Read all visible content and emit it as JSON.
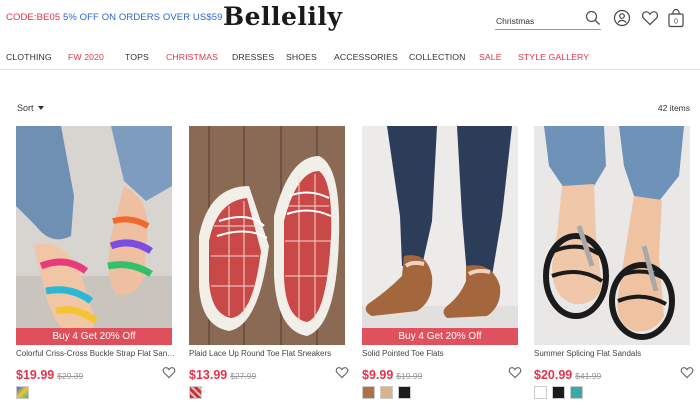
{
  "header": {
    "promo_code": "CODE:BE05",
    "promo_text": "5% OFF ON ORDERS OVER US$59",
    "logo": "Bellelily",
    "search_value": "Christmas",
    "cart_count": "0"
  },
  "nav": [
    {
      "label": "CLOTHING",
      "highlight": false
    },
    {
      "label": "FW 2020",
      "highlight": true
    },
    {
      "label": "TOPS",
      "highlight": false
    },
    {
      "label": "CHRISTMAS",
      "highlight": true
    },
    {
      "label": "DRESSES",
      "highlight": false
    },
    {
      "label": "SHOES",
      "highlight": false
    },
    {
      "label": "ACCESSORIES",
      "highlight": false
    },
    {
      "label": "COLLECTION",
      "highlight": false
    },
    {
      "label": "SALE",
      "highlight": true
    },
    {
      "label": "STYLE GALLERY",
      "highlight": true
    }
  ],
  "toolbar": {
    "sort_label": "Sort",
    "item_count": "42 items"
  },
  "colors": {
    "accent": "#e0344a",
    "promo_blue": "#2a66c7",
    "promo_strip": "#e04452"
  },
  "products": [
    {
      "name": "Colorful Criss-Cross Buckle Strap Flat Sand...",
      "price": "$19.99",
      "old_price": "$29.39",
      "promo": "Buy 4 Get 20% Off",
      "swatches": [
        "#2b6fd6"
      ]
    },
    {
      "name": "Plaid Lace Up Round Toe Flat Sneakers",
      "price": "$13.99",
      "old_price": "$27.99",
      "promo": "",
      "swatches": [
        "#c0343a"
      ]
    },
    {
      "name": "Solid Pointed Toe Flats",
      "price": "$9.99",
      "old_price": "$19.99",
      "promo": "Buy 4 Get 20% Off",
      "swatches": [
        "#b06f4b",
        "#d9b48c",
        "#1c1c1c"
      ]
    },
    {
      "name": "Summer Splicing Flat Sandals",
      "price": "$20.99",
      "old_price": "$41.99",
      "promo": "",
      "swatches": [
        "#ffffff",
        "#1a1a1a",
        "#3aa9a5"
      ]
    }
  ]
}
